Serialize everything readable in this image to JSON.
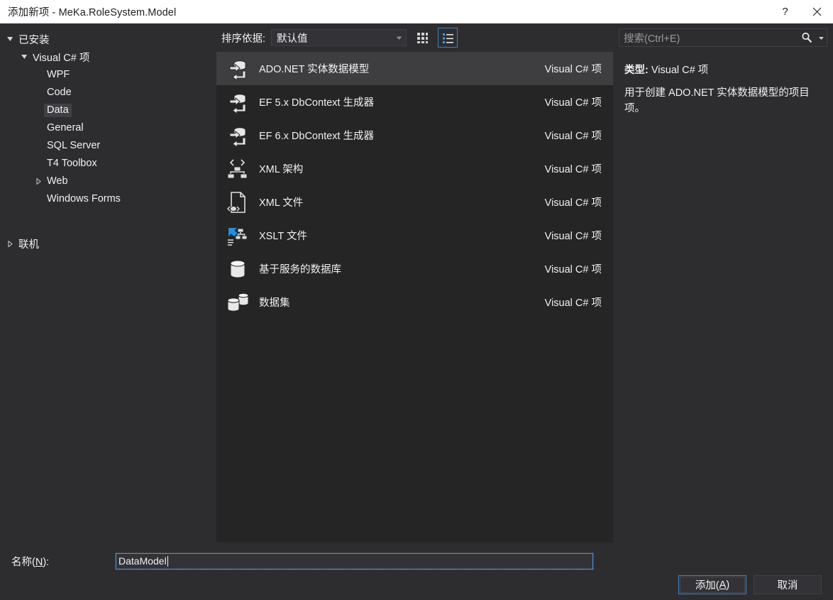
{
  "window": {
    "title": "添加新项 - MeKa.RoleSystem.Model",
    "help_label": "?",
    "close_label": "✕"
  },
  "tree": {
    "nodes": [
      {
        "label": "已安装",
        "depth": 0,
        "state": "expanded",
        "selected": false
      },
      {
        "label": "Visual C# 项",
        "depth": 1,
        "state": "expanded",
        "selected": false
      },
      {
        "label": "WPF",
        "depth": 2,
        "state": "leaf",
        "selected": false
      },
      {
        "label": "Code",
        "depth": 2,
        "state": "leaf",
        "selected": false
      },
      {
        "label": "Data",
        "depth": 2,
        "state": "leaf",
        "selected": true
      },
      {
        "label": "General",
        "depth": 2,
        "state": "leaf",
        "selected": false
      },
      {
        "label": "SQL Server",
        "depth": 2,
        "state": "leaf",
        "selected": false
      },
      {
        "label": "T4 Toolbox",
        "depth": 2,
        "state": "leaf",
        "selected": false
      },
      {
        "label": "Web",
        "depth": 2,
        "state": "collapsed",
        "selected": false
      },
      {
        "label": "Windows Forms",
        "depth": 2,
        "state": "leaf",
        "selected": false
      },
      {
        "label": "联机",
        "depth": 0,
        "state": "collapsed",
        "selected": false
      }
    ]
  },
  "toolbar": {
    "sort_label": "排序依据:",
    "sort_value": "默认值",
    "grid_view_name": "grid-view-icon",
    "list_view_name": "list-view-icon",
    "active_view": "list"
  },
  "search": {
    "placeholder": "搜索(Ctrl+E)",
    "icon": "search-icon"
  },
  "items": [
    {
      "name": "ADO.NET 实体数据模型",
      "kind": "Visual C# 项",
      "icon": "entity-data-model-icon",
      "selected": true
    },
    {
      "name": "EF 5.x DbContext 生成器",
      "kind": "Visual C# 项",
      "icon": "entity-data-model-icon",
      "selected": false
    },
    {
      "name": "EF 6.x DbContext 生成器",
      "kind": "Visual C# 项",
      "icon": "entity-data-model-icon",
      "selected": false
    },
    {
      "name": "XML 架构",
      "kind": "Visual C# 项",
      "icon": "xml-schema-icon",
      "selected": false
    },
    {
      "name": "XML 文件",
      "kind": "Visual C# 项",
      "icon": "xml-file-icon",
      "selected": false
    },
    {
      "name": "XSLT 文件",
      "kind": "Visual C# 项",
      "icon": "xslt-file-icon",
      "selected": false
    },
    {
      "name": "基于服务的数据库",
      "kind": "Visual C# 项",
      "icon": "database-icon",
      "selected": false
    },
    {
      "name": "数据集",
      "kind": "Visual C# 项",
      "icon": "dataset-icon",
      "selected": false
    }
  ],
  "details": {
    "type_label": "类型:",
    "type_value": "Visual C# 项",
    "description": "用于创建 ADO.NET 实体数据模型的项目项。"
  },
  "footer": {
    "name_label_prefix": "名称(",
    "name_label_accel": "N",
    "name_label_suffix": "):",
    "name_value": "DataModel",
    "add_prefix": "添加(",
    "add_accel": "A",
    "add_suffix": ")",
    "cancel_label": "取消"
  },
  "colors": {
    "dialog_bg": "#2d2d30",
    "list_bg": "#252526",
    "selection_bg": "#3e3e40",
    "accent": "#3f7fbf",
    "titlebar_bg": "#ffffff",
    "text": "#f1f1f1"
  }
}
